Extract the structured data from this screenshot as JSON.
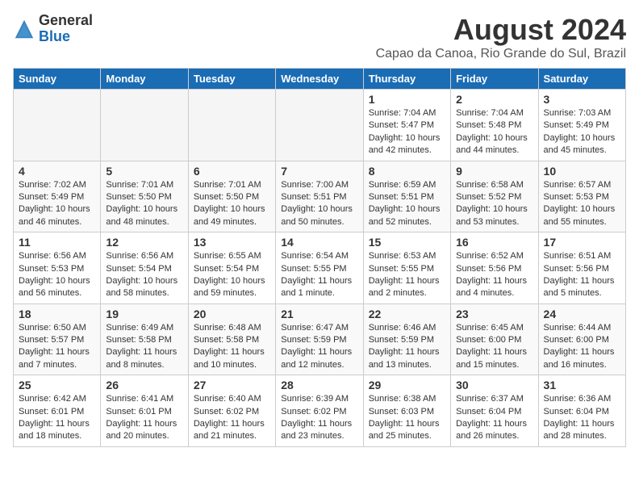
{
  "header": {
    "logo_general": "General",
    "logo_blue": "Blue",
    "month_title": "August 2024",
    "location": "Capao da Canoa, Rio Grande do Sul, Brazil"
  },
  "weekdays": [
    "Sunday",
    "Monday",
    "Tuesday",
    "Wednesday",
    "Thursday",
    "Friday",
    "Saturday"
  ],
  "weeks": [
    [
      {
        "day": "",
        "content": ""
      },
      {
        "day": "",
        "content": ""
      },
      {
        "day": "",
        "content": ""
      },
      {
        "day": "",
        "content": ""
      },
      {
        "day": "1",
        "content": "Sunrise: 7:04 AM\nSunset: 5:47 PM\nDaylight: 10 hours\nand 42 minutes."
      },
      {
        "day": "2",
        "content": "Sunrise: 7:04 AM\nSunset: 5:48 PM\nDaylight: 10 hours\nand 44 minutes."
      },
      {
        "day": "3",
        "content": "Sunrise: 7:03 AM\nSunset: 5:49 PM\nDaylight: 10 hours\nand 45 minutes."
      }
    ],
    [
      {
        "day": "4",
        "content": "Sunrise: 7:02 AM\nSunset: 5:49 PM\nDaylight: 10 hours\nand 46 minutes."
      },
      {
        "day": "5",
        "content": "Sunrise: 7:01 AM\nSunset: 5:50 PM\nDaylight: 10 hours\nand 48 minutes."
      },
      {
        "day": "6",
        "content": "Sunrise: 7:01 AM\nSunset: 5:50 PM\nDaylight: 10 hours\nand 49 minutes."
      },
      {
        "day": "7",
        "content": "Sunrise: 7:00 AM\nSunset: 5:51 PM\nDaylight: 10 hours\nand 50 minutes."
      },
      {
        "day": "8",
        "content": "Sunrise: 6:59 AM\nSunset: 5:51 PM\nDaylight: 10 hours\nand 52 minutes."
      },
      {
        "day": "9",
        "content": "Sunrise: 6:58 AM\nSunset: 5:52 PM\nDaylight: 10 hours\nand 53 minutes."
      },
      {
        "day": "10",
        "content": "Sunrise: 6:57 AM\nSunset: 5:53 PM\nDaylight: 10 hours\nand 55 minutes."
      }
    ],
    [
      {
        "day": "11",
        "content": "Sunrise: 6:56 AM\nSunset: 5:53 PM\nDaylight: 10 hours\nand 56 minutes."
      },
      {
        "day": "12",
        "content": "Sunrise: 6:56 AM\nSunset: 5:54 PM\nDaylight: 10 hours\nand 58 minutes."
      },
      {
        "day": "13",
        "content": "Sunrise: 6:55 AM\nSunset: 5:54 PM\nDaylight: 10 hours\nand 59 minutes."
      },
      {
        "day": "14",
        "content": "Sunrise: 6:54 AM\nSunset: 5:55 PM\nDaylight: 11 hours\nand 1 minute."
      },
      {
        "day": "15",
        "content": "Sunrise: 6:53 AM\nSunset: 5:55 PM\nDaylight: 11 hours\nand 2 minutes."
      },
      {
        "day": "16",
        "content": "Sunrise: 6:52 AM\nSunset: 5:56 PM\nDaylight: 11 hours\nand 4 minutes."
      },
      {
        "day": "17",
        "content": "Sunrise: 6:51 AM\nSunset: 5:56 PM\nDaylight: 11 hours\nand 5 minutes."
      }
    ],
    [
      {
        "day": "18",
        "content": "Sunrise: 6:50 AM\nSunset: 5:57 PM\nDaylight: 11 hours\nand 7 minutes."
      },
      {
        "day": "19",
        "content": "Sunrise: 6:49 AM\nSunset: 5:58 PM\nDaylight: 11 hours\nand 8 minutes."
      },
      {
        "day": "20",
        "content": "Sunrise: 6:48 AM\nSunset: 5:58 PM\nDaylight: 11 hours\nand 10 minutes."
      },
      {
        "day": "21",
        "content": "Sunrise: 6:47 AM\nSunset: 5:59 PM\nDaylight: 11 hours\nand 12 minutes."
      },
      {
        "day": "22",
        "content": "Sunrise: 6:46 AM\nSunset: 5:59 PM\nDaylight: 11 hours\nand 13 minutes."
      },
      {
        "day": "23",
        "content": "Sunrise: 6:45 AM\nSunset: 6:00 PM\nDaylight: 11 hours\nand 15 minutes."
      },
      {
        "day": "24",
        "content": "Sunrise: 6:44 AM\nSunset: 6:00 PM\nDaylight: 11 hours\nand 16 minutes."
      }
    ],
    [
      {
        "day": "25",
        "content": "Sunrise: 6:42 AM\nSunset: 6:01 PM\nDaylight: 11 hours\nand 18 minutes."
      },
      {
        "day": "26",
        "content": "Sunrise: 6:41 AM\nSunset: 6:01 PM\nDaylight: 11 hours\nand 20 minutes."
      },
      {
        "day": "27",
        "content": "Sunrise: 6:40 AM\nSunset: 6:02 PM\nDaylight: 11 hours\nand 21 minutes."
      },
      {
        "day": "28",
        "content": "Sunrise: 6:39 AM\nSunset: 6:02 PM\nDaylight: 11 hours\nand 23 minutes."
      },
      {
        "day": "29",
        "content": "Sunrise: 6:38 AM\nSunset: 6:03 PM\nDaylight: 11 hours\nand 25 minutes."
      },
      {
        "day": "30",
        "content": "Sunrise: 6:37 AM\nSunset: 6:04 PM\nDaylight: 11 hours\nand 26 minutes."
      },
      {
        "day": "31",
        "content": "Sunrise: 6:36 AM\nSunset: 6:04 PM\nDaylight: 11 hours\nand 28 minutes."
      }
    ]
  ]
}
